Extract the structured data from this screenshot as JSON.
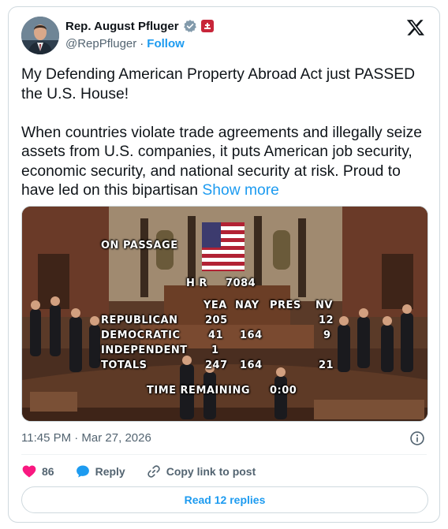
{
  "author": {
    "display_name": "Rep. August Pfluger",
    "handle": "@RepPfluger",
    "separator": "·",
    "follow_label": "Follow"
  },
  "tweet": {
    "text": "My Defending American Property Abroad Act just PASSED the U.S. House!\n\nWhen countries violate trade agreements and illegally seize assets from U.S. companies, it puts American job security, economic security, and national security at risk. Proud to have led on this bipartisan ",
    "show_more": "Show more"
  },
  "media": {
    "heading": "ON PASSAGE",
    "bill_label": "H R",
    "bill_number": "7084",
    "columns": [
      "YEA",
      "NAY",
      "PRES",
      "NV"
    ],
    "rows": [
      {
        "party": "REPUBLICAN",
        "yea": "205",
        "nay": "",
        "pres": "",
        "nv": "12"
      },
      {
        "party": "DEMOCRATIC",
        "yea": "41",
        "nay": "164",
        "pres": "",
        "nv": "9"
      },
      {
        "party": "INDEPENDENT",
        "yea": "1",
        "nay": "",
        "pres": "",
        "nv": ""
      },
      {
        "party": "TOTALS",
        "yea": "247",
        "nay": "164",
        "pres": "",
        "nv": "21"
      }
    ],
    "time_label": "TIME REMAINING",
    "time_value": "0:00"
  },
  "meta": {
    "timestamp": "11:45 PM · Mar 27, 2026"
  },
  "actions": {
    "like_count": "86",
    "reply_label": "Reply",
    "copy_label": "Copy link to post"
  },
  "replies_button": "Read 12 replies",
  "colors": {
    "accent": "#1d9bf0",
    "like": "#f91880",
    "text_secondary": "#536471"
  },
  "icons": [
    "verified-badge-icon",
    "government-badge-icon",
    "x-logo-icon",
    "info-icon",
    "heart-icon",
    "reply-bubble-icon",
    "link-icon"
  ]
}
